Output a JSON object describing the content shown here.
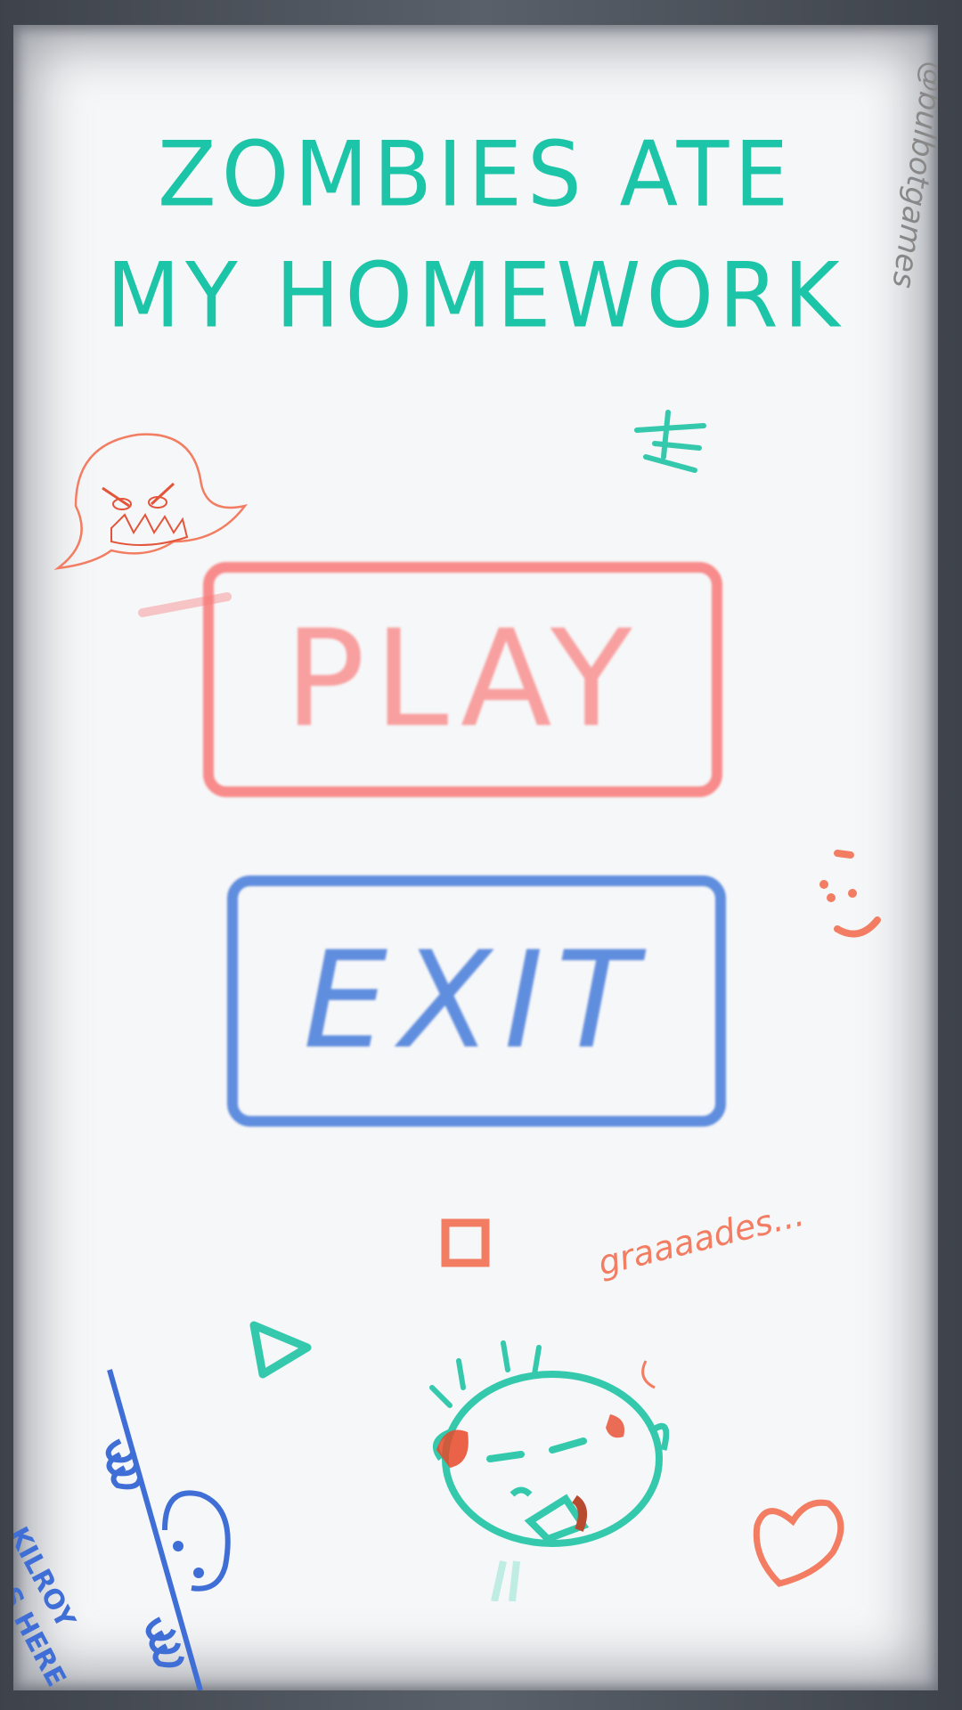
{
  "title": {
    "line1": "ZOMBIES ATE",
    "line2": "MY HOMEWORK"
  },
  "watermark": "@bulbotgames",
  "menu": {
    "play_label": "PLAY",
    "exit_label": "EXIT"
  },
  "doodles": {
    "kilroy_text": "KILROY\nWAS HERE",
    "zombie_speech": "graaaades..."
  },
  "colors": {
    "title": "#1cc4a8",
    "play": "#f87878",
    "exit": "#5082dc",
    "doodle_red": "#f27d62",
    "doodle_blue": "#3f6fd6",
    "doodle_teal": "#34c9ad"
  }
}
